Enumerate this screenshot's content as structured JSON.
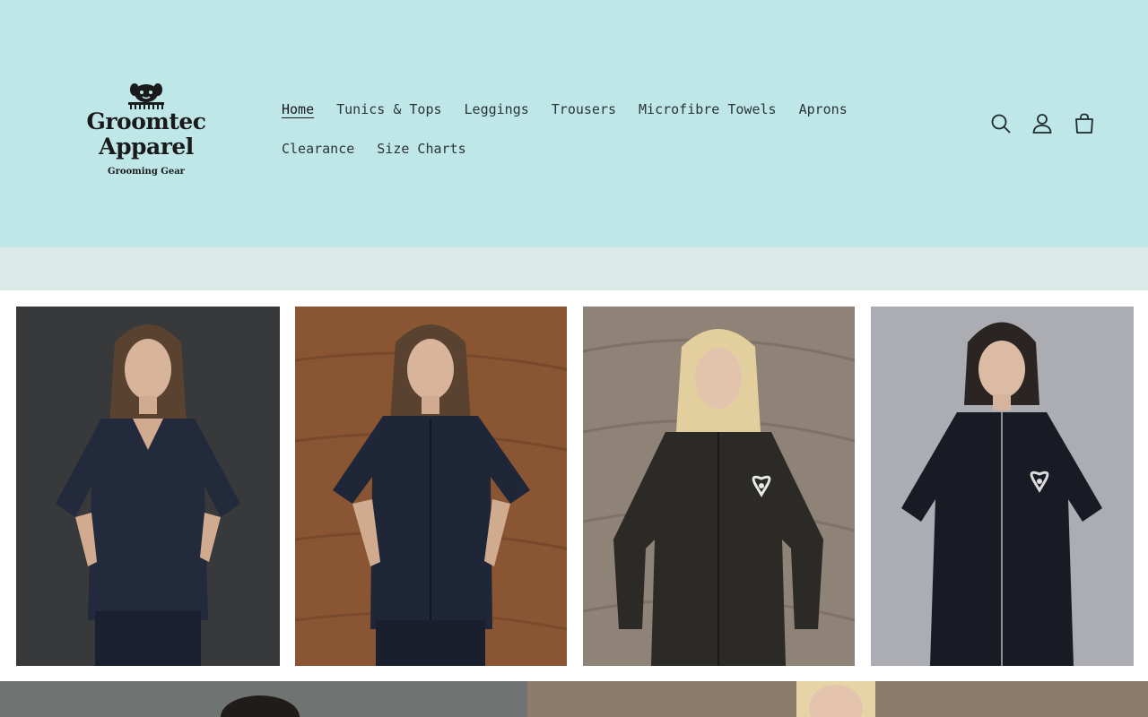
{
  "header": {
    "logo": {
      "name_line1": "Groomtec",
      "name_line2": "Apparel",
      "tagline": "Grooming Gear"
    },
    "nav": {
      "row1": [
        "Home",
        "Tunics & Tops",
        "Leggings",
        "Trousers",
        "Microfibre Towels",
        "Aprons"
      ],
      "row2": [
        "Clearance",
        "Size Charts"
      ],
      "active": "Home"
    },
    "icons": [
      "search-icon",
      "account-icon",
      "cart-icon"
    ]
  },
  "colors": {
    "header_bg": "#bfe7e8",
    "band_bg": "#dbe9e7",
    "text": "#1f2a2a"
  },
  "products": [
    {
      "name": "navy-v-neck-tunic",
      "background": "dark slate"
    },
    {
      "name": "navy-zip-tunic",
      "background": "brown wood"
    },
    {
      "name": "black-long-sleeve-jacket",
      "background": "grey wood"
    },
    {
      "name": "black-zip-tunic-paw-heart",
      "background": "grey concrete"
    }
  ]
}
